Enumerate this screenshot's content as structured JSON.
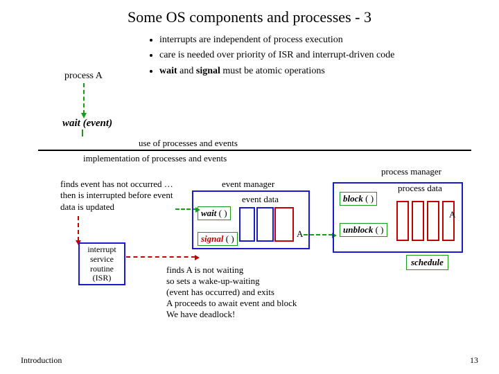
{
  "title": "Some OS components and processes - 3",
  "bullets": {
    "b1": "interrupts are independent of process execution",
    "b2": "care is needed over priority of ISR and interrupt-driven code",
    "b3_pre": "",
    "b3_wait": "wait",
    "b3_mid": " and ",
    "b3_signal": "signal",
    "b3_post": " must be atomic operations"
  },
  "processA_label": "process A",
  "wait_event_label": "wait (event)",
  "use_of": "use of processes and events",
  "impl_of": "implementation of processes and events",
  "find_text": "finds event has not occurred … then is interrupted before event data is updated",
  "event_manager": {
    "title": "event manager",
    "event_data": "event data",
    "wait_fn": "wait",
    "signal_fn": "signal",
    "paren": " ( )",
    "a_label": "A"
  },
  "process_manager": {
    "title": "process manager",
    "process_data": "process data",
    "block_fn": "block",
    "unblock_fn": "unblock",
    "paren": " ( )",
    "a_label": "A",
    "schedule": "schedule"
  },
  "isr": {
    "l1": "interrupt",
    "l2": "service",
    "l3": "routine",
    "l4": "(ISR)"
  },
  "findsA": "finds A is not waiting\nso sets a wake-up-waiting\n(event has occurred) and exits\nA proceeds to await event and block\nWe have deadlock!",
  "footer": {
    "left": "Introduction",
    "right": "13"
  }
}
